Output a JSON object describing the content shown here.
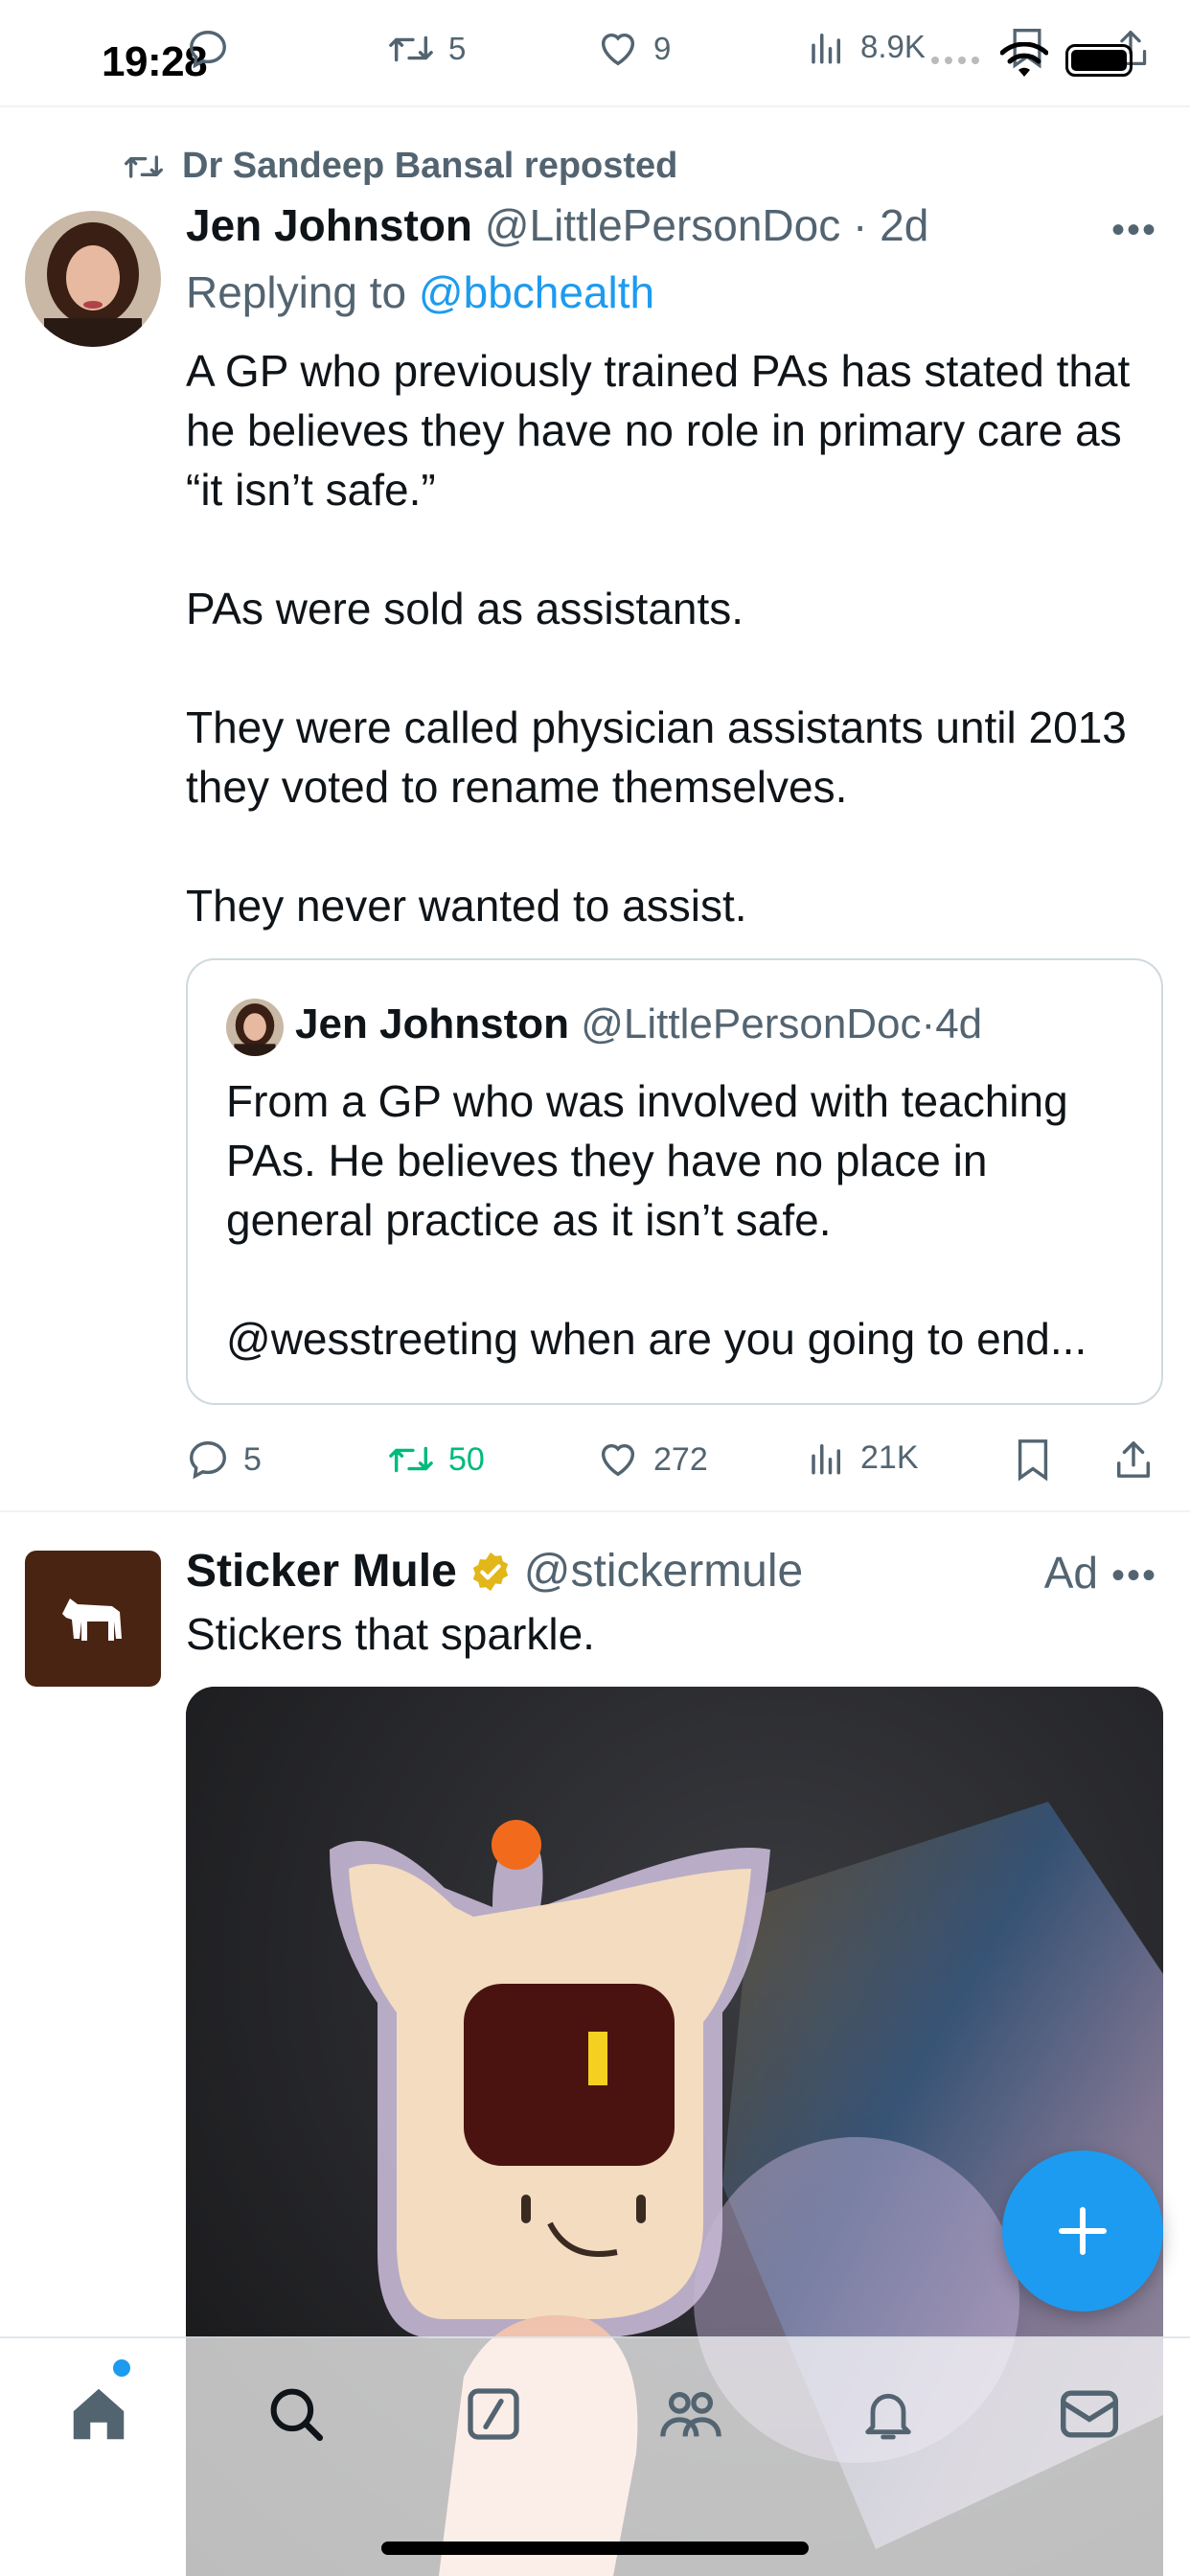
{
  "status_bar": {
    "time": "19:28"
  },
  "prev_tweet_actions": {
    "replies": "",
    "retweets": "5",
    "likes": "9",
    "views": "8.9K"
  },
  "tweet": {
    "repost_label": "Dr Sandeep Bansal reposted",
    "author_name": "Jen Johnston",
    "author_handle": "@LittlePersonDoc",
    "separator": "·",
    "time": "2d",
    "replying_prefix": "Replying to ",
    "replying_to": "@bbchealth",
    "paragraphs": [
      "A GP who previously trained PAs has stated that he believes they have no role in primary care as “it isn’t safe.”",
      "PAs were sold as assistants.",
      "They were called physician assistants until 2013 they voted to rename themselves.",
      "They never wanted to assist."
    ],
    "quote": {
      "author_name": "Jen Johnston",
      "author_handle": "@LittlePersonDoc",
      "separator": "·",
      "time": "4d",
      "paragraphs": [
        "From a GP who was involved with teaching PAs. He believes they have no place in general practice as it isn’t safe.",
        "@wesstreeting when are you going to end..."
      ]
    },
    "actions": {
      "replies": "5",
      "retweets": "50",
      "likes": "272",
      "views": "21K"
    }
  },
  "ad": {
    "brand_name": "Sticker Mule",
    "handle": "@stickermule",
    "ad_label": "Ad",
    "text": "Stickers that sparkle."
  },
  "colors": {
    "accent": "#1d9bf0",
    "retweet_green": "#00ba7c",
    "secondary_text": "#536471",
    "verified_gold": "#e2b719",
    "brand_bg": "#4a2412"
  },
  "icons": {
    "bottom_nav": [
      "home-icon",
      "search-icon",
      "grok-icon",
      "communities-icon",
      "notifications-icon",
      "messages-icon"
    ]
  }
}
